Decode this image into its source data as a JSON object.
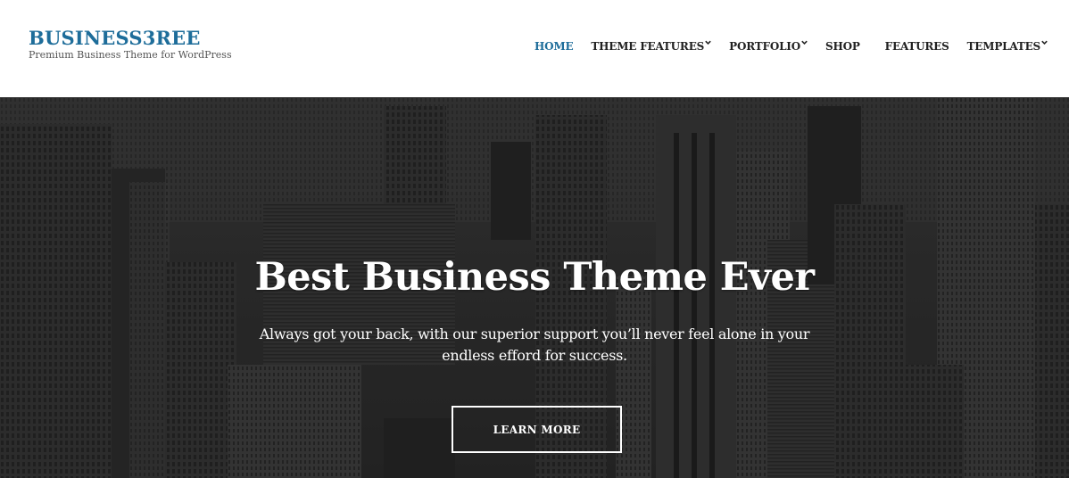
{
  "header": {
    "site_title": "BUSINESS3REE",
    "tagline": "Premium Business Theme for WordPress"
  },
  "nav": {
    "items": [
      {
        "label": "HOME",
        "active": true,
        "has_dropdown": false
      },
      {
        "label": "THEME FEATURES",
        "active": false,
        "has_dropdown": true
      },
      {
        "label": "PORTFOLIO",
        "active": false,
        "has_dropdown": true
      },
      {
        "label": "SHOP",
        "active": false,
        "has_dropdown": false
      },
      {
        "label": "FEATURES",
        "active": false,
        "has_dropdown": false
      },
      {
        "label": "TEMPLATES",
        "active": false,
        "has_dropdown": true
      }
    ]
  },
  "hero": {
    "title": "Best Business Theme Ever",
    "subtitle": "Always got your back, with our superior support you’ll never feel alone in your endless efford for success.",
    "button_label": "LEARN MORE",
    "background": "city-skyline-grayscale-image"
  },
  "colors": {
    "brand": "#1e6d9a",
    "nav_text": "#222222",
    "tagline": "#555555",
    "hero_text": "#ffffff"
  }
}
